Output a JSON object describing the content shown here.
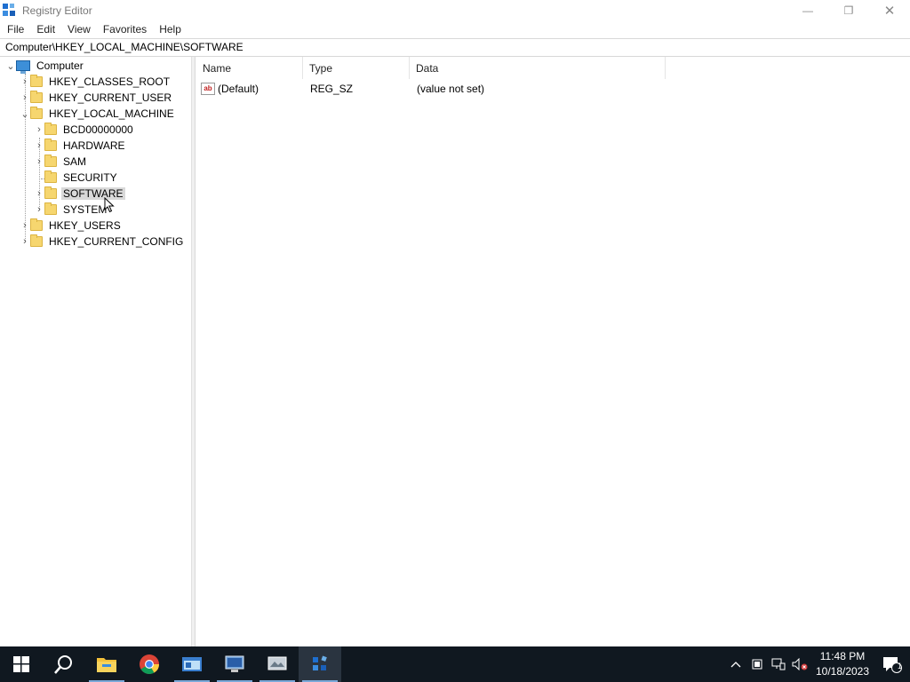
{
  "window": {
    "title": "Registry Editor",
    "minimize_glyph": "—",
    "restore_glyph": "❐",
    "close_glyph": "✕"
  },
  "menu": [
    "File",
    "Edit",
    "View",
    "Favorites",
    "Help"
  ],
  "address": "Computer\\HKEY_LOCAL_MACHINE\\SOFTWARE",
  "tree": {
    "root": "Computer",
    "hives": [
      {
        "label": "HKEY_CLASSES_ROOT"
      },
      {
        "label": "HKEY_CURRENT_USER"
      },
      {
        "label": "HKEY_LOCAL_MACHINE"
      },
      {
        "label": "HKEY_USERS"
      },
      {
        "label": "HKEY_CURRENT_CONFIG"
      }
    ],
    "hklm_children": [
      {
        "label": "BCD00000000"
      },
      {
        "label": "HARDWARE"
      },
      {
        "label": "SAM"
      },
      {
        "label": "SECURITY"
      },
      {
        "label": "SOFTWARE"
      },
      {
        "label": "SYSTEM"
      }
    ],
    "selected": "SOFTWARE"
  },
  "list": {
    "columns": [
      "Name",
      "Type",
      "Data"
    ],
    "rows": [
      {
        "name": "(Default)",
        "type": "REG_SZ",
        "data": "(value not set)",
        "icon": "ab"
      }
    ]
  },
  "taskbar": {
    "apps": [
      "start-icon",
      "search-icon",
      "file-explorer-icon",
      "chrome-icon",
      "app-icon-1",
      "app-icon-2",
      "app-icon-3",
      "registry-editor-icon"
    ],
    "time": "11:48 PM",
    "date": "10/18/2023",
    "notification_count": "1"
  }
}
